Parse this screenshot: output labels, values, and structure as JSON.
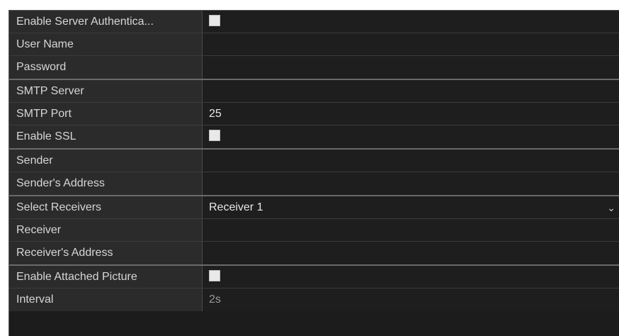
{
  "server_auth": {
    "enable_label": "Enable Server Authentica...",
    "user_name_label": "User Name",
    "user_name_value": "",
    "password_label": "Password",
    "password_value": ""
  },
  "smtp": {
    "server_label": "SMTP Server",
    "server_value": "",
    "port_label": "SMTP Port",
    "port_value": "25",
    "ssl_label": "Enable SSL"
  },
  "sender": {
    "name_label": "Sender",
    "name_value": "",
    "address_label": "Sender's Address",
    "address_value": ""
  },
  "receivers": {
    "select_label": "Select Receivers",
    "select_value": "Receiver 1",
    "receiver_label": "Receiver",
    "receiver_value": "",
    "address_label": "Receiver's Address",
    "address_value": ""
  },
  "attachment": {
    "enable_label": "Enable Attached Picture",
    "interval_label": "Interval",
    "interval_value": "2s"
  },
  "icons": {
    "checkbox": "checkbox-icon",
    "dropdown": "chevron-down-icon"
  }
}
